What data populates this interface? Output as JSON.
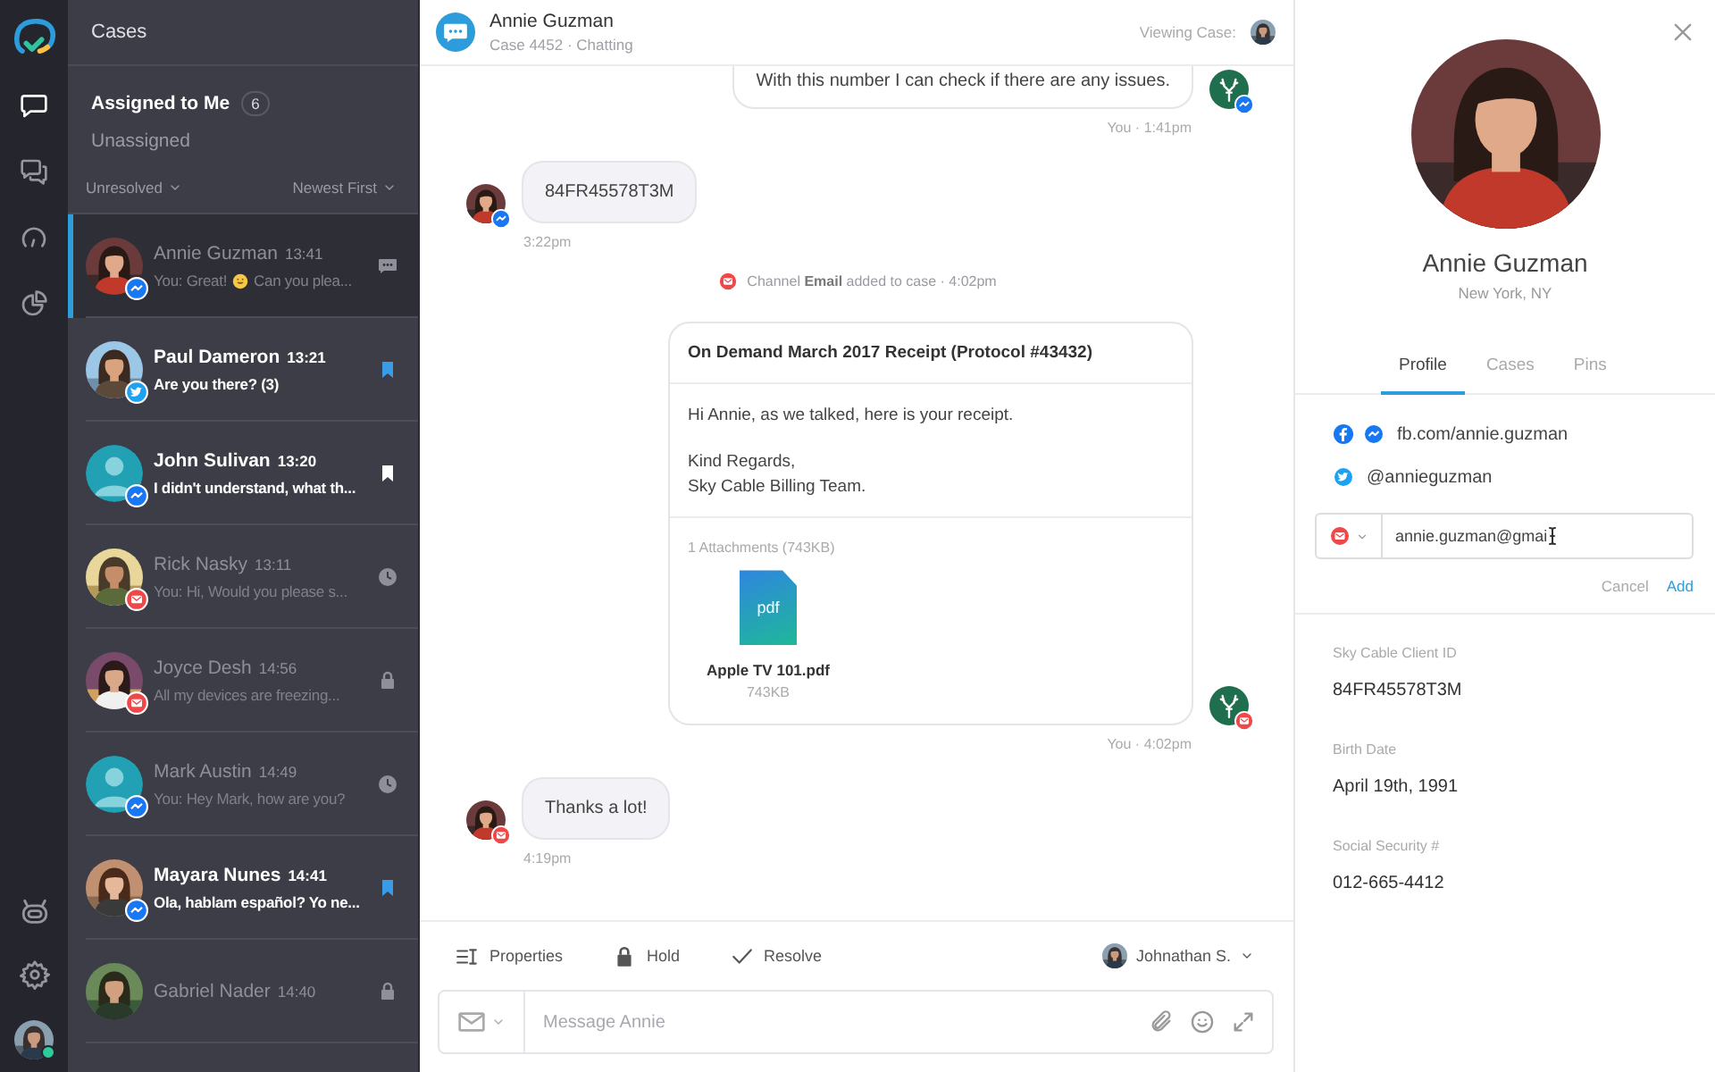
{
  "rail": {
    "nav": [
      {
        "kind": "chat",
        "selected": true
      },
      {
        "kind": "chats",
        "selected": false
      },
      {
        "kind": "gauge",
        "selected": false
      },
      {
        "kind": "pie",
        "selected": false
      }
    ],
    "tools": [
      {
        "kind": "robot"
      },
      {
        "kind": "settings"
      }
    ],
    "user": {
      "online": true
    }
  },
  "cases": {
    "title": "Cases",
    "tabs": [
      {
        "label": "Assigned to Me",
        "count": "6",
        "selected": true
      },
      {
        "label": "Unassigned",
        "selected": false
      }
    ],
    "status_filter": "Unresolved",
    "sort": "Newest First",
    "items": [
      {
        "name": "Annie Guzman",
        "time": "13:41",
        "preview": "You: Great!",
        "emoji": {
          "kind": "smile"
        },
        "preview_rest": "Can you plea...",
        "channel": {
          "kind": "messenger"
        },
        "status": {
          "kind": "chat"
        },
        "unread": false,
        "selected": true
      },
      {
        "name": "Paul Dameron",
        "time": "13:21",
        "preview": "Are you there? (3)",
        "channel": {
          "kind": "twitter"
        },
        "status": {
          "kind": "pinned"
        },
        "unread": true,
        "selected": false
      },
      {
        "name": "John Sulivan",
        "time": "13:20",
        "preview": "I didn't understand, what th...",
        "avatar": {
          "kind": "default"
        },
        "channel": {
          "kind": "messenger"
        },
        "status": {
          "kind": "bookmark"
        },
        "unread": true,
        "selected": false
      },
      {
        "name": "Rick Nasky",
        "time": "13:11",
        "preview": "You: Hi, Would you please s...",
        "channel": {
          "kind": "email"
        },
        "status": {
          "kind": "clock"
        },
        "unread": false,
        "selected": false
      },
      {
        "name": "Joyce Desh",
        "time": "14:56",
        "preview": "All my devices are freezing...",
        "channel": {
          "kind": "email"
        },
        "status": {
          "kind": "lock"
        },
        "unread": false,
        "selected": false
      },
      {
        "name": "Mark Austin",
        "time": "14:49",
        "preview": "You: Hey Mark, how are you?",
        "avatar": {
          "kind": "default"
        },
        "channel": {
          "kind": "messenger"
        },
        "status": {
          "kind": "clock"
        },
        "unread": false,
        "selected": false
      },
      {
        "name": "Mayara Nunes",
        "time": "14:41",
        "preview": "Ola, hablam español? Yo ne...",
        "channel": {
          "kind": "messenger"
        },
        "status": {
          "kind": "pinned"
        },
        "unread": true,
        "selected": false
      },
      {
        "name": "Gabriel Nader",
        "time": "14:40",
        "status": {
          "kind": "lock"
        },
        "unread": false,
        "selected": false
      }
    ]
  },
  "chat": {
    "header": {
      "name": "Annie Guzman",
      "subtitle": "Case 4452 · Chatting",
      "viewing_label": "Viewing Case:"
    },
    "messages": [
      {
        "kind": "outgoing",
        "text": "With this number I can check if there are any issues.",
        "channel": {
          "kind": "messenger"
        },
        "meta": "You · 1:41pm",
        "cut_top": true
      },
      {
        "kind": "incoming",
        "text": "84FR45578T3M",
        "channel": {
          "kind": "messenger"
        },
        "time": "3:22pm"
      },
      {
        "kind": "event",
        "text": "Channel **Email** added to case · 4:02pm",
        "channel": {
          "kind": "email"
        }
      },
      {
        "kind": "email",
        "subject": "On Demand March 2017 Receipt (Protocol #43432)",
        "body": [
          "Hi Annie, as we talked, here is your receipt.",
          "Kind Regards,\nSky Cable Billing Team."
        ],
        "attachments_label": "1 Attachments (743KB)",
        "file": {
          "type_label": "pdf",
          "name": "Apple TV 101.pdf",
          "size": "743KB"
        },
        "channel": {
          "kind": "email"
        },
        "meta": "You · 4:02pm"
      },
      {
        "kind": "incoming",
        "text": "Thanks a lot!",
        "channel": {
          "kind": "email"
        },
        "time": "4:19pm"
      }
    ],
    "actions": [
      {
        "kind": "properties",
        "label": "Properties"
      },
      {
        "kind": "hold",
        "label": "Hold"
      },
      {
        "kind": "resolve",
        "label": "Resolve"
      }
    ],
    "agent": "Johnathan S.",
    "composer": {
      "placeholder": "Message Annie"
    }
  },
  "profile": {
    "name": "Annie Guzman",
    "location": "New York, NY",
    "tabs": [
      {
        "label": "Profile",
        "selected": true
      },
      {
        "label": "Cases",
        "selected": false
      },
      {
        "label": "Pins",
        "selected": false
      }
    ],
    "contacts": [
      {
        "kind": "facebook",
        "text": "fb.com/annie.guzman"
      },
      {
        "kind": "twitter",
        "text": "@annieguzman"
      }
    ],
    "new_contact": {
      "channel": {
        "kind": "email"
      },
      "value": "annie.guzman@gmai"
    },
    "form_buttons": [
      {
        "kind": "cancel",
        "label": "Cancel"
      },
      {
        "kind": "add",
        "label": "Add"
      }
    ],
    "fields": [
      {
        "label": "Sky Cable Client ID",
        "value": "84FR45578T3M"
      },
      {
        "label": "Birth Date",
        "value": "April 19th, 1991"
      },
      {
        "label": "Social Security #",
        "value": "012-665-4412"
      }
    ]
  }
}
